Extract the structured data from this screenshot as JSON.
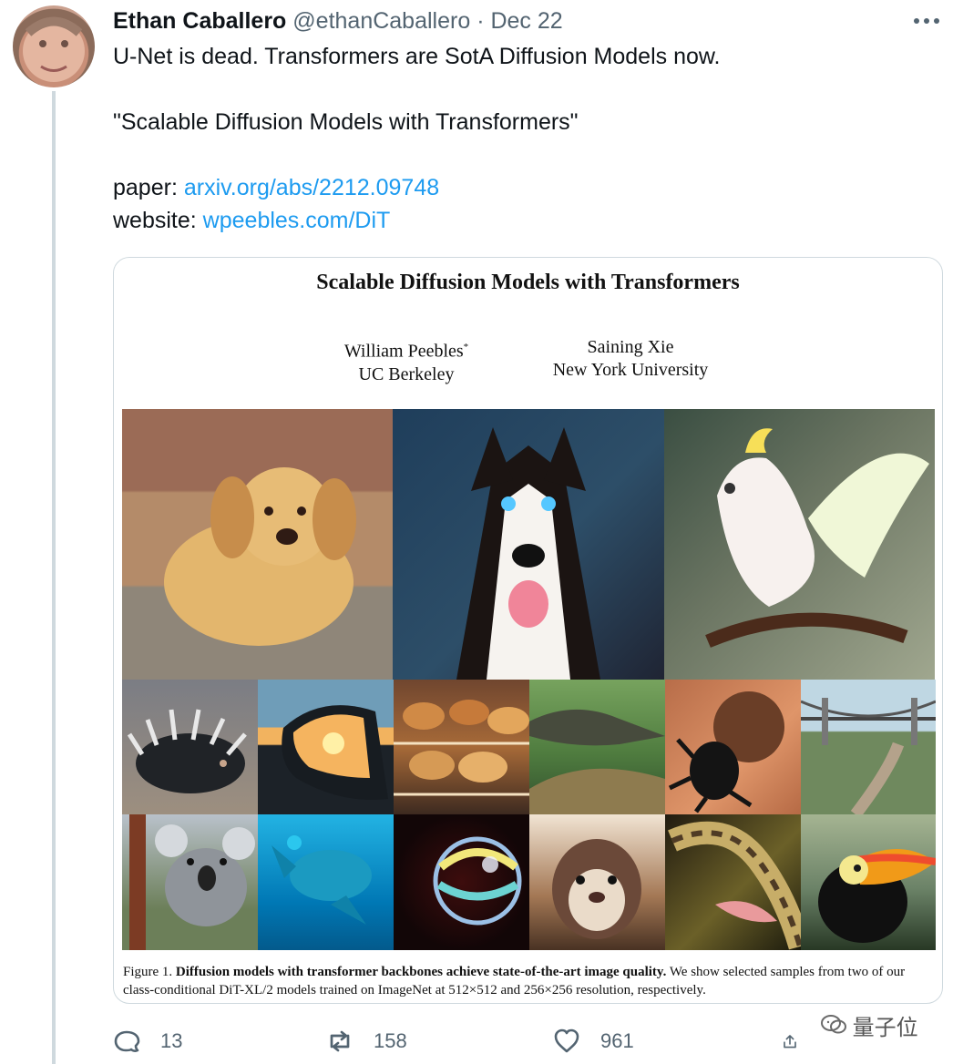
{
  "tweet": {
    "author_name": "Ethan Caballero",
    "handle": "@ethanCaballero",
    "date_separator": "·",
    "date": "Dec 22",
    "more_icon": "more-horizontal-icon",
    "line1": "U-Net is dead. Transformers are SotA Diffusion Models now.",
    "line2": "\"Scalable Diffusion Models with Transformers\"",
    "paper_label": "paper: ",
    "paper_link": "arxiv.org/abs/2212.09748",
    "website_label": "website: ",
    "website_link": "wpeebles.com/DiT"
  },
  "card": {
    "title": "Scalable Diffusion Models with Transformers",
    "author1_name": "William Peebles",
    "author1_mark": "*",
    "author1_affiliation": "UC Berkeley",
    "author2_name": "Saining Xie",
    "author2_affiliation": "New York University",
    "caption_prefix": "Figure 1.",
    "caption_bold": "Diffusion models with transformer backbones achieve state-of-the-art image quality.",
    "caption_rest": "We show selected samples from two of our class-conditional DiT-XL/2 models trained on ImageNet at 512×512 and 256×256 resolution, respectively.",
    "images": [
      "golden retriever puppy",
      "husky",
      "cockatoo",
      "porcupine",
      "side mirror sunset",
      "pastry display",
      "crocodile",
      "dung beetle",
      "suspension bridge",
      "koala",
      "sea turtle",
      "soap bubble",
      "ferret",
      "snake",
      "toucan"
    ]
  },
  "watermark": "量子位",
  "actions": {
    "replies": "13",
    "retweets": "158",
    "likes": "961",
    "reply_icon": "reply-icon",
    "retweet_icon": "retweet-icon",
    "like_icon": "heart-icon",
    "share_icon": "share-icon"
  }
}
